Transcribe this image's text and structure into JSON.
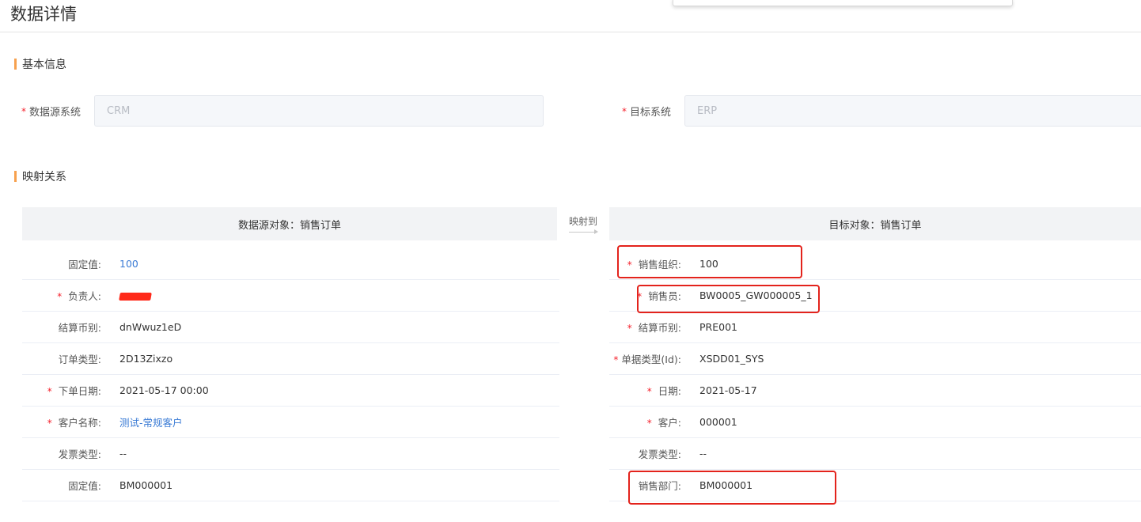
{
  "page": {
    "title": "数据详情"
  },
  "colors": {
    "accent": "#f7a14e",
    "required": "#f5222d",
    "link": "#3a7bd5",
    "highlight": "#e3231c"
  },
  "basic_info": {
    "title": "基本信息",
    "source_system": {
      "label": "数据源系统",
      "value": "CRM",
      "required": true
    },
    "target_system": {
      "label": "目标系统",
      "value": "ERP",
      "required": true
    }
  },
  "mapping": {
    "title": "映射关系",
    "source_header": "数据源对象：销售订单",
    "arrow_label": "映射到",
    "target_header": "目标对象：销售订单",
    "source_rows": [
      {
        "label": "固定值:",
        "value": "100",
        "required": false,
        "link": true
      },
      {
        "label": "负责人:",
        "value": "",
        "required": true,
        "redacted": true
      },
      {
        "label": "结算币别:",
        "value": "dnWwuz1eD",
        "required": false
      },
      {
        "label": "订单类型:",
        "value": "2D13Zixzo",
        "required": false
      },
      {
        "label": "下单日期:",
        "value": "2021-05-17 00:00",
        "required": true
      },
      {
        "label": "客户名称:",
        "value": "测试-常规客户",
        "required": true,
        "link": true
      },
      {
        "label": "发票类型:",
        "value": "--",
        "required": false
      },
      {
        "label": "固定值:",
        "value": "BM000001",
        "required": false
      }
    ],
    "target_rows": [
      {
        "label": "销售组织:",
        "value": "100",
        "required": true
      },
      {
        "label": "销售员:",
        "value": "BW0005_GW000005_1",
        "required": true
      },
      {
        "label": "结算币别:",
        "value": "PRE001",
        "required": true
      },
      {
        "label": "单据类型(Id):",
        "value": "XSDD01_SYS",
        "required": true
      },
      {
        "label": "日期:",
        "value": "2021-05-17",
        "required": true
      },
      {
        "label": "客户:",
        "value": "000001",
        "required": true
      },
      {
        "label": "发票类型:",
        "value": "--",
        "required": false
      },
      {
        "label": "销售部门:",
        "value": "BM000001",
        "required": false
      }
    ]
  }
}
